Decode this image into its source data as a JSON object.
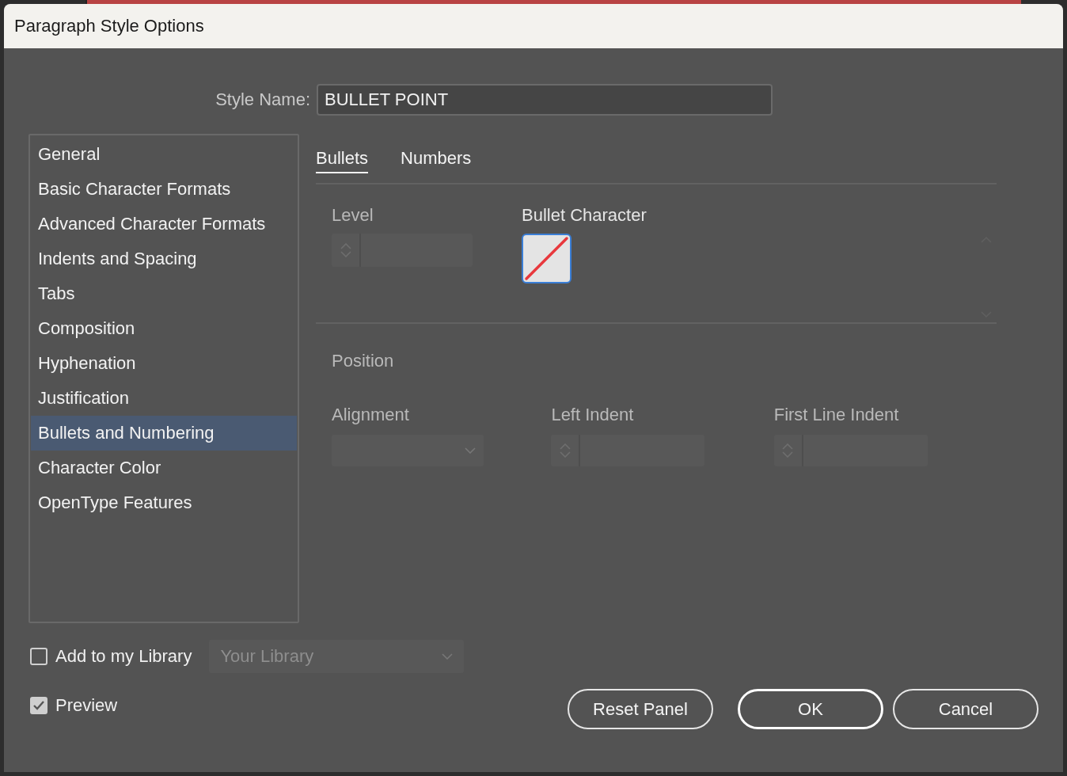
{
  "window": {
    "title": "Paragraph Style Options"
  },
  "style_name": {
    "label": "Style Name:",
    "value": "BULLET POINT"
  },
  "sidebar": {
    "items": [
      {
        "label": "General",
        "selected": false
      },
      {
        "label": "Basic Character Formats",
        "selected": false
      },
      {
        "label": "Advanced Character Formats",
        "selected": false
      },
      {
        "label": "Indents and Spacing",
        "selected": false
      },
      {
        "label": "Tabs",
        "selected": false
      },
      {
        "label": "Composition",
        "selected": false
      },
      {
        "label": "Hyphenation",
        "selected": false
      },
      {
        "label": "Justification",
        "selected": false
      },
      {
        "label": "Bullets and Numbering",
        "selected": true
      },
      {
        "label": "Character Color",
        "selected": false
      },
      {
        "label": "OpenType Features",
        "selected": false
      }
    ]
  },
  "tabs": [
    {
      "label": "Bullets",
      "selected": true
    },
    {
      "label": "Numbers",
      "selected": false
    }
  ],
  "level": {
    "label": "Level",
    "disabled": true
  },
  "bullet_character": {
    "label": "Bullet Character",
    "swatch_selected": true
  },
  "position": {
    "heading": "Position",
    "fields": [
      {
        "kind": "dropdown",
        "label": "Alignment",
        "disabled": true
      },
      {
        "kind": "stepper",
        "label": "Left Indent",
        "disabled": true
      },
      {
        "kind": "stepper",
        "label": "First Line Indent",
        "disabled": true
      }
    ]
  },
  "library": {
    "label": "Add to my Library",
    "checked": false,
    "placeholder": "Your Library",
    "disabled": true
  },
  "preview": {
    "label": "Preview",
    "checked": true
  },
  "buttons": [
    {
      "label": "Reset Panel",
      "default": false
    },
    {
      "label": "OK",
      "default": true
    },
    {
      "label": "Cancel",
      "default": false
    }
  ]
}
